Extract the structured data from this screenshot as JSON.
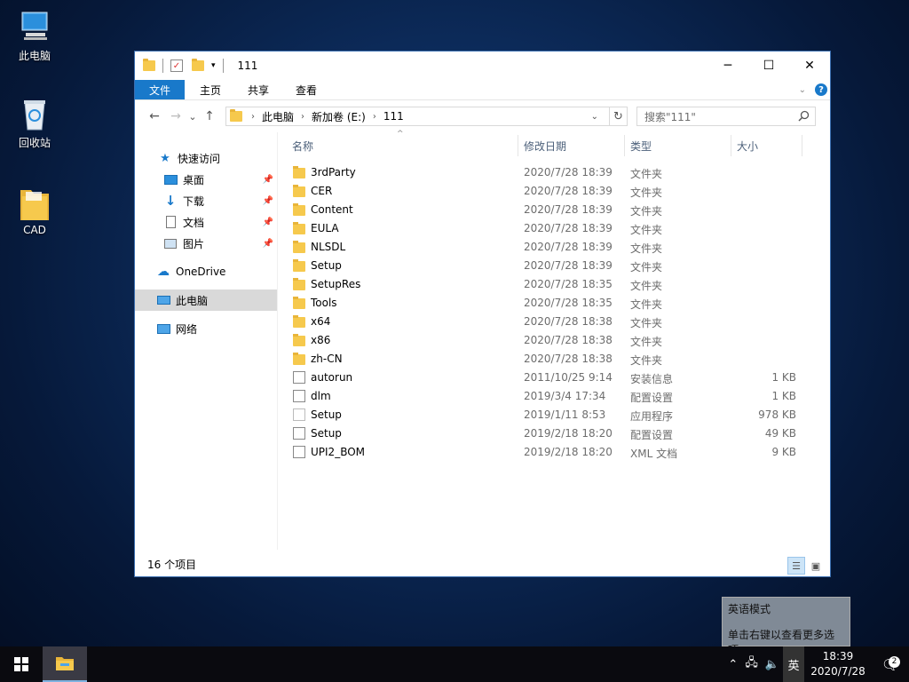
{
  "desktop": {
    "icons": [
      {
        "label": "此电脑"
      },
      {
        "label": "回收站"
      },
      {
        "label": "CAD"
      }
    ]
  },
  "window": {
    "title": "111",
    "controls": {
      "minimize": "─",
      "maximize": "☐",
      "close": "✕"
    },
    "ribbon": {
      "tabs": [
        "文件",
        "主页",
        "共享",
        "查看"
      ]
    },
    "nav": {
      "back": "←",
      "forward": "→",
      "recent": "⌄",
      "up": "↑",
      "breadcrumb": [
        "此电脑",
        "新加卷 (E:)",
        "111"
      ],
      "search_placeholder": "搜索\"111\""
    },
    "sidebar": {
      "quick_access": "快速访问",
      "items": [
        {
          "label": "桌面"
        },
        {
          "label": "下载"
        },
        {
          "label": "文档"
        },
        {
          "label": "图片"
        }
      ],
      "onedrive": "OneDrive",
      "this_pc": "此电脑",
      "network": "网络"
    },
    "columns": {
      "name": "名称",
      "modified": "修改日期",
      "type": "类型",
      "size": "大小"
    },
    "files": [
      {
        "name": "3rdParty",
        "modified": "2020/7/28 18:39",
        "type": "文件夹",
        "size": "",
        "icon": "folder-icon"
      },
      {
        "name": "CER",
        "modified": "2020/7/28 18:39",
        "type": "文件夹",
        "size": "",
        "icon": "folder-icon"
      },
      {
        "name": "Content",
        "modified": "2020/7/28 18:39",
        "type": "文件夹",
        "size": "",
        "icon": "folder-icon"
      },
      {
        "name": "EULA",
        "modified": "2020/7/28 18:39",
        "type": "文件夹",
        "size": "",
        "icon": "folder-icon"
      },
      {
        "name": "NLSDL",
        "modified": "2020/7/28 18:39",
        "type": "文件夹",
        "size": "",
        "icon": "folder-icon"
      },
      {
        "name": "Setup",
        "modified": "2020/7/28 18:39",
        "type": "文件夹",
        "size": "",
        "icon": "folder-icon"
      },
      {
        "name": "SetupRes",
        "modified": "2020/7/28 18:35",
        "type": "文件夹",
        "size": "",
        "icon": "folder-icon"
      },
      {
        "name": "Tools",
        "modified": "2020/7/28 18:35",
        "type": "文件夹",
        "size": "",
        "icon": "folder-icon"
      },
      {
        "name": "x64",
        "modified": "2020/7/28 18:38",
        "type": "文件夹",
        "size": "",
        "icon": "folder-icon"
      },
      {
        "name": "x86",
        "modified": "2020/7/28 18:38",
        "type": "文件夹",
        "size": "",
        "icon": "folder-icon"
      },
      {
        "name": "zh-CN",
        "modified": "2020/7/28 18:38",
        "type": "文件夹",
        "size": "",
        "icon": "folder-icon"
      },
      {
        "name": "autorun",
        "modified": "2011/10/25 9:14",
        "type": "安装信息",
        "size": "1 KB",
        "icon": "settings-file-icon"
      },
      {
        "name": "dlm",
        "modified": "2019/3/4 17:34",
        "type": "配置设置",
        "size": "1 KB",
        "icon": "settings-file-icon"
      },
      {
        "name": "Setup",
        "modified": "2019/1/11 8:53",
        "type": "应用程序",
        "size": "978 KB",
        "icon": "autodesk-app-icon"
      },
      {
        "name": "Setup",
        "modified": "2019/2/18 18:20",
        "type": "配置设置",
        "size": "49 KB",
        "icon": "settings-file-icon"
      },
      {
        "name": "UPI2_BOM",
        "modified": "2019/2/18 18:20",
        "type": "XML 文档",
        "size": "9 KB",
        "icon": "xml-file-icon"
      }
    ],
    "status": "16 个项目"
  },
  "ime_tooltip": {
    "line1": "英语模式",
    "line2": "单击右键以查看更多选项"
  },
  "taskbar": {
    "ime": "英",
    "time": "18:39",
    "date": "2020/7/28",
    "notifications": "2"
  },
  "colors": {
    "accent": "#1979ca",
    "folder": "#f6c94d",
    "selection": "#d9d9d9"
  }
}
